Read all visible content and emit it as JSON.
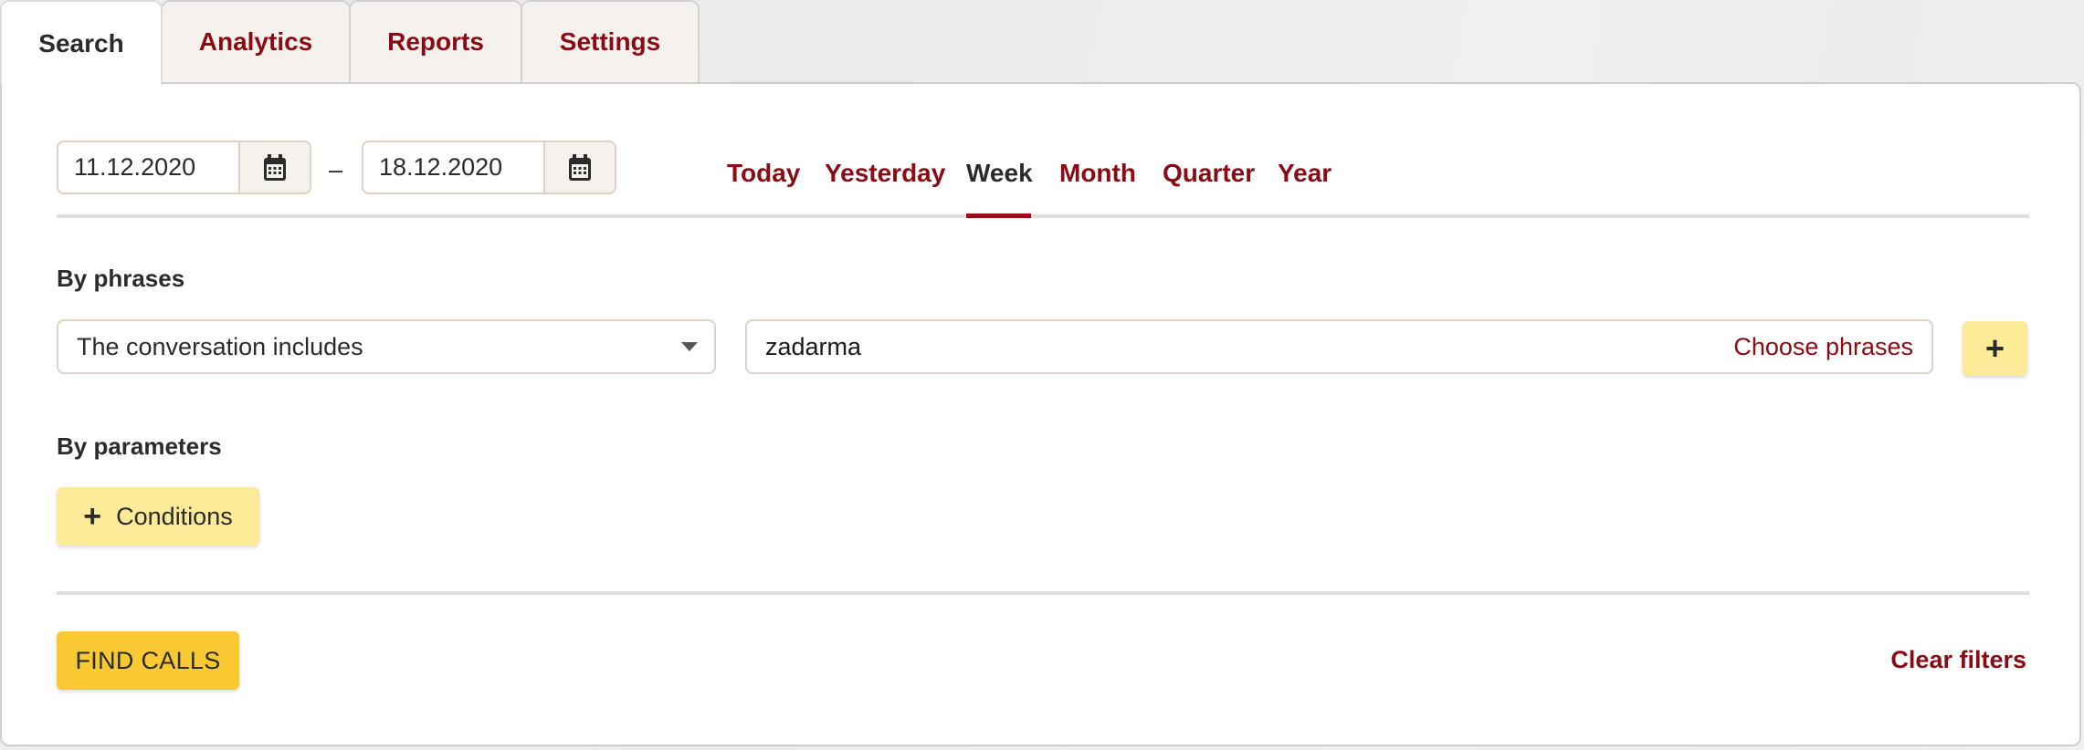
{
  "tabs": [
    {
      "label": "Search",
      "active": true
    },
    {
      "label": "Analytics",
      "active": false
    },
    {
      "label": "Reports",
      "active": false
    },
    {
      "label": "Settings",
      "active": false
    }
  ],
  "date_range": {
    "from": "11.12.2020",
    "to": "18.12.2020",
    "separator": "–",
    "calendar_icon": "calendar-icon"
  },
  "periods": [
    {
      "label": "Today",
      "active": false
    },
    {
      "label": "Yesterday",
      "active": false
    },
    {
      "label": "Week",
      "active": true
    },
    {
      "label": "Month",
      "active": false
    },
    {
      "label": "Quarter",
      "active": false
    },
    {
      "label": "Year",
      "active": false
    }
  ],
  "by_phrases": {
    "heading": "By phrases",
    "condition_select": "The conversation includes",
    "phrase_value": "zadarma",
    "choose_phrases_link": "Choose phrases",
    "add_button": "+"
  },
  "by_parameters": {
    "heading": "By parameters",
    "conditions_button_icon": "+",
    "conditions_button": "Conditions"
  },
  "footer": {
    "find_calls_button": "FIND CALLS",
    "clear_filters_link": "Clear filters"
  },
  "colors": {
    "accent": "#8b0a14",
    "text": "#2b2b2b",
    "button_primary": "#f9c933",
    "button_secondary": "#fbeb99",
    "field_border": "#ddd2c6"
  }
}
